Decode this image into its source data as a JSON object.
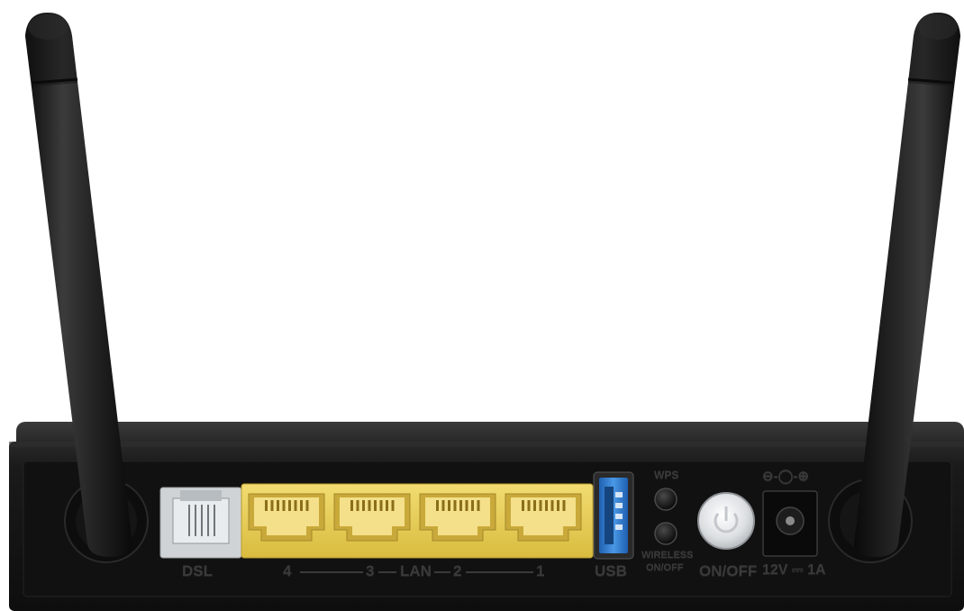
{
  "device": {
    "name": "router-rear-panel",
    "colors": {
      "body": "#151515",
      "lan_ports": "#e9cf5a",
      "dsl_port": "#cfd3d6",
      "usb_port": "#3a86d8",
      "background": "#ffffff"
    }
  },
  "labels": {
    "dsl": "DSL",
    "lan_4": "4",
    "lan_3": "3",
    "lan": "LAN",
    "lan_2": "2",
    "lan_1": "1",
    "usb": "USB",
    "wps": "WPS",
    "wireless_line1": "WIRELESS",
    "wireless_line2": "ON/OFF",
    "power": "ON/OFF",
    "dc_rating": "12V ⎓ 1A",
    "polarity_symbol": "⊖-◯-⊕"
  },
  "icons": {
    "power_button": "power-icon",
    "antenna": "antenna-icon"
  }
}
